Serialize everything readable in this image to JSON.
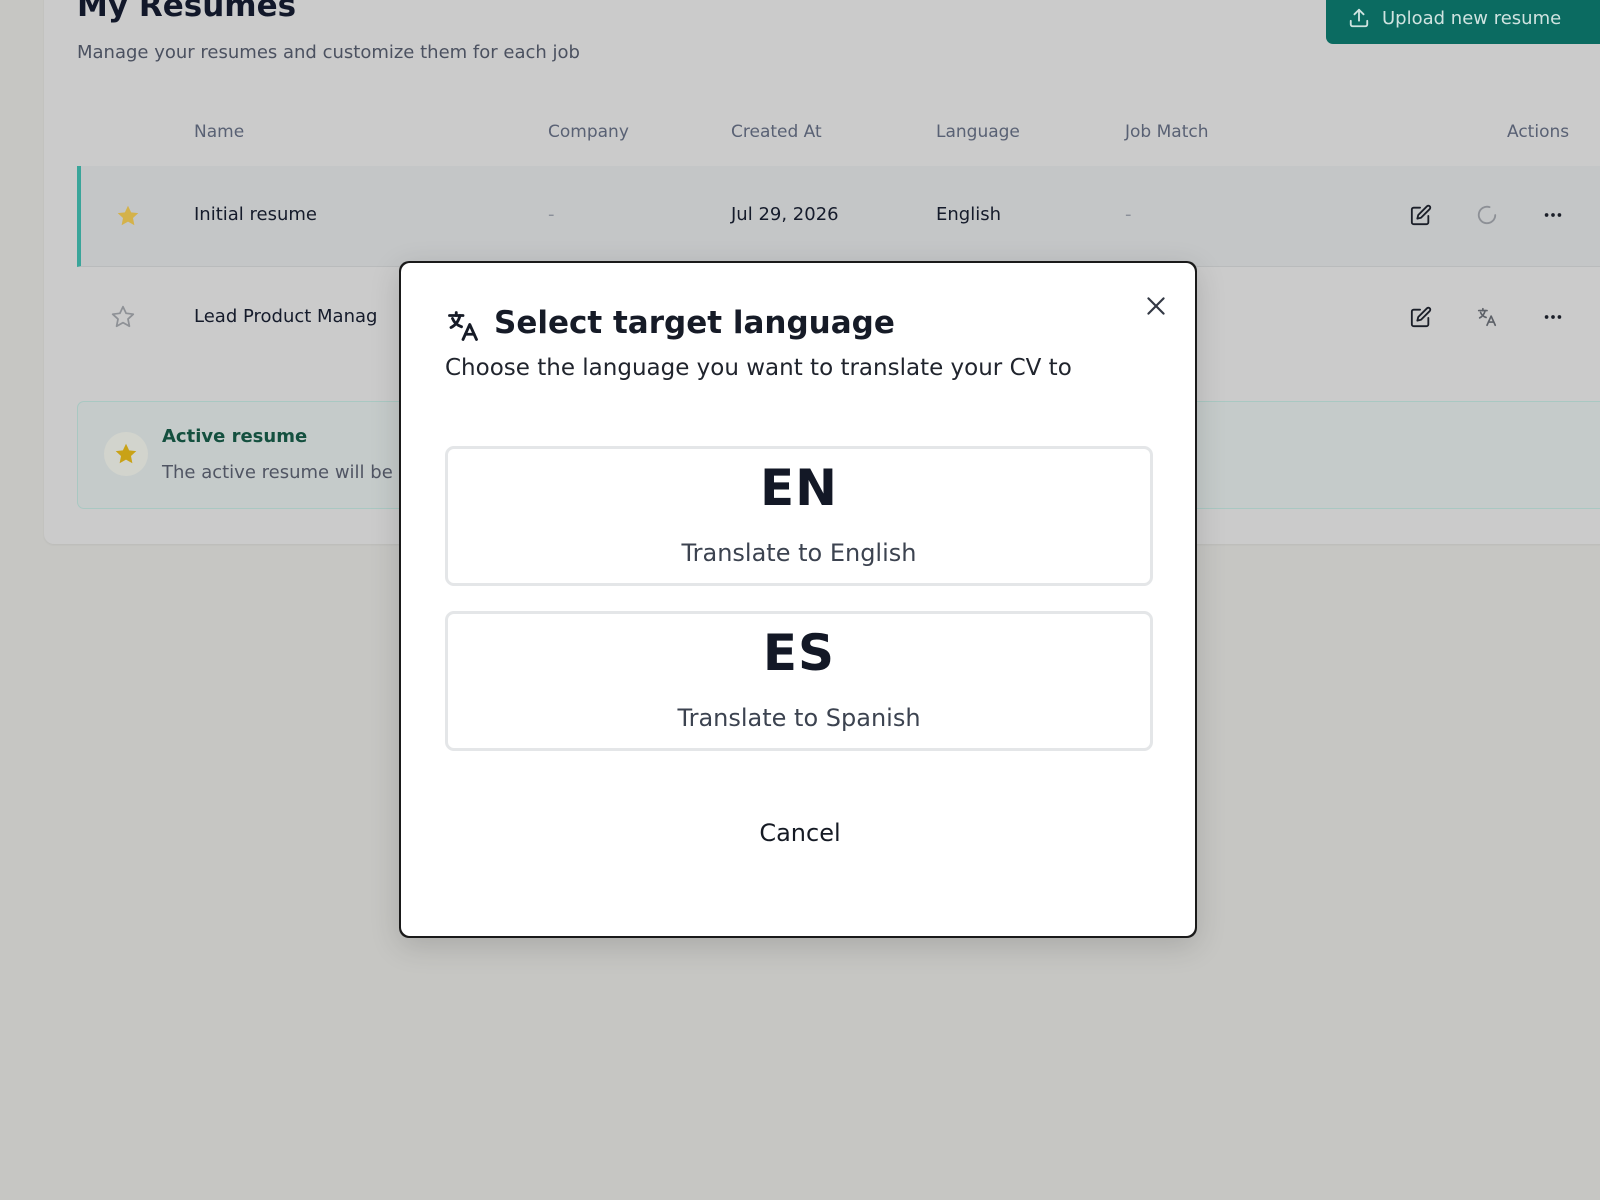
{
  "page": {
    "title": "My Resumes",
    "subtitle": "Manage your resumes and customize them for each job",
    "upload_label": "Upload new resume"
  },
  "table": {
    "headers": {
      "name": "Name",
      "company": "Company",
      "created_at": "Created At",
      "language": "Language",
      "job_match": "Job Match",
      "actions": "Actions"
    },
    "rows": [
      {
        "starred": true,
        "name": "Initial resume",
        "company": "-",
        "created_at": "Jul 29, 2026",
        "language": "English",
        "job_match": "-",
        "actions": [
          "edit-icon",
          "loading-spinner-icon",
          "more-options-icon"
        ]
      },
      {
        "starred": false,
        "name": "Lead Product Manag",
        "actions": [
          "edit-icon",
          "translate-icon",
          "more-options-icon"
        ]
      }
    ]
  },
  "info": {
    "title": "Active resume",
    "text": "The active resume will be"
  },
  "modal": {
    "title": "Select target language",
    "description": "Choose the language you want to translate your CV to",
    "options": [
      {
        "code": "EN",
        "label": "Translate to English"
      },
      {
        "code": "ES",
        "label": "Translate to Spanish"
      }
    ],
    "cancel_label": "Cancel"
  },
  "colors": {
    "accent": "#0b6b61",
    "star": "#d4a82c",
    "overlay": "#c6c6c3"
  }
}
